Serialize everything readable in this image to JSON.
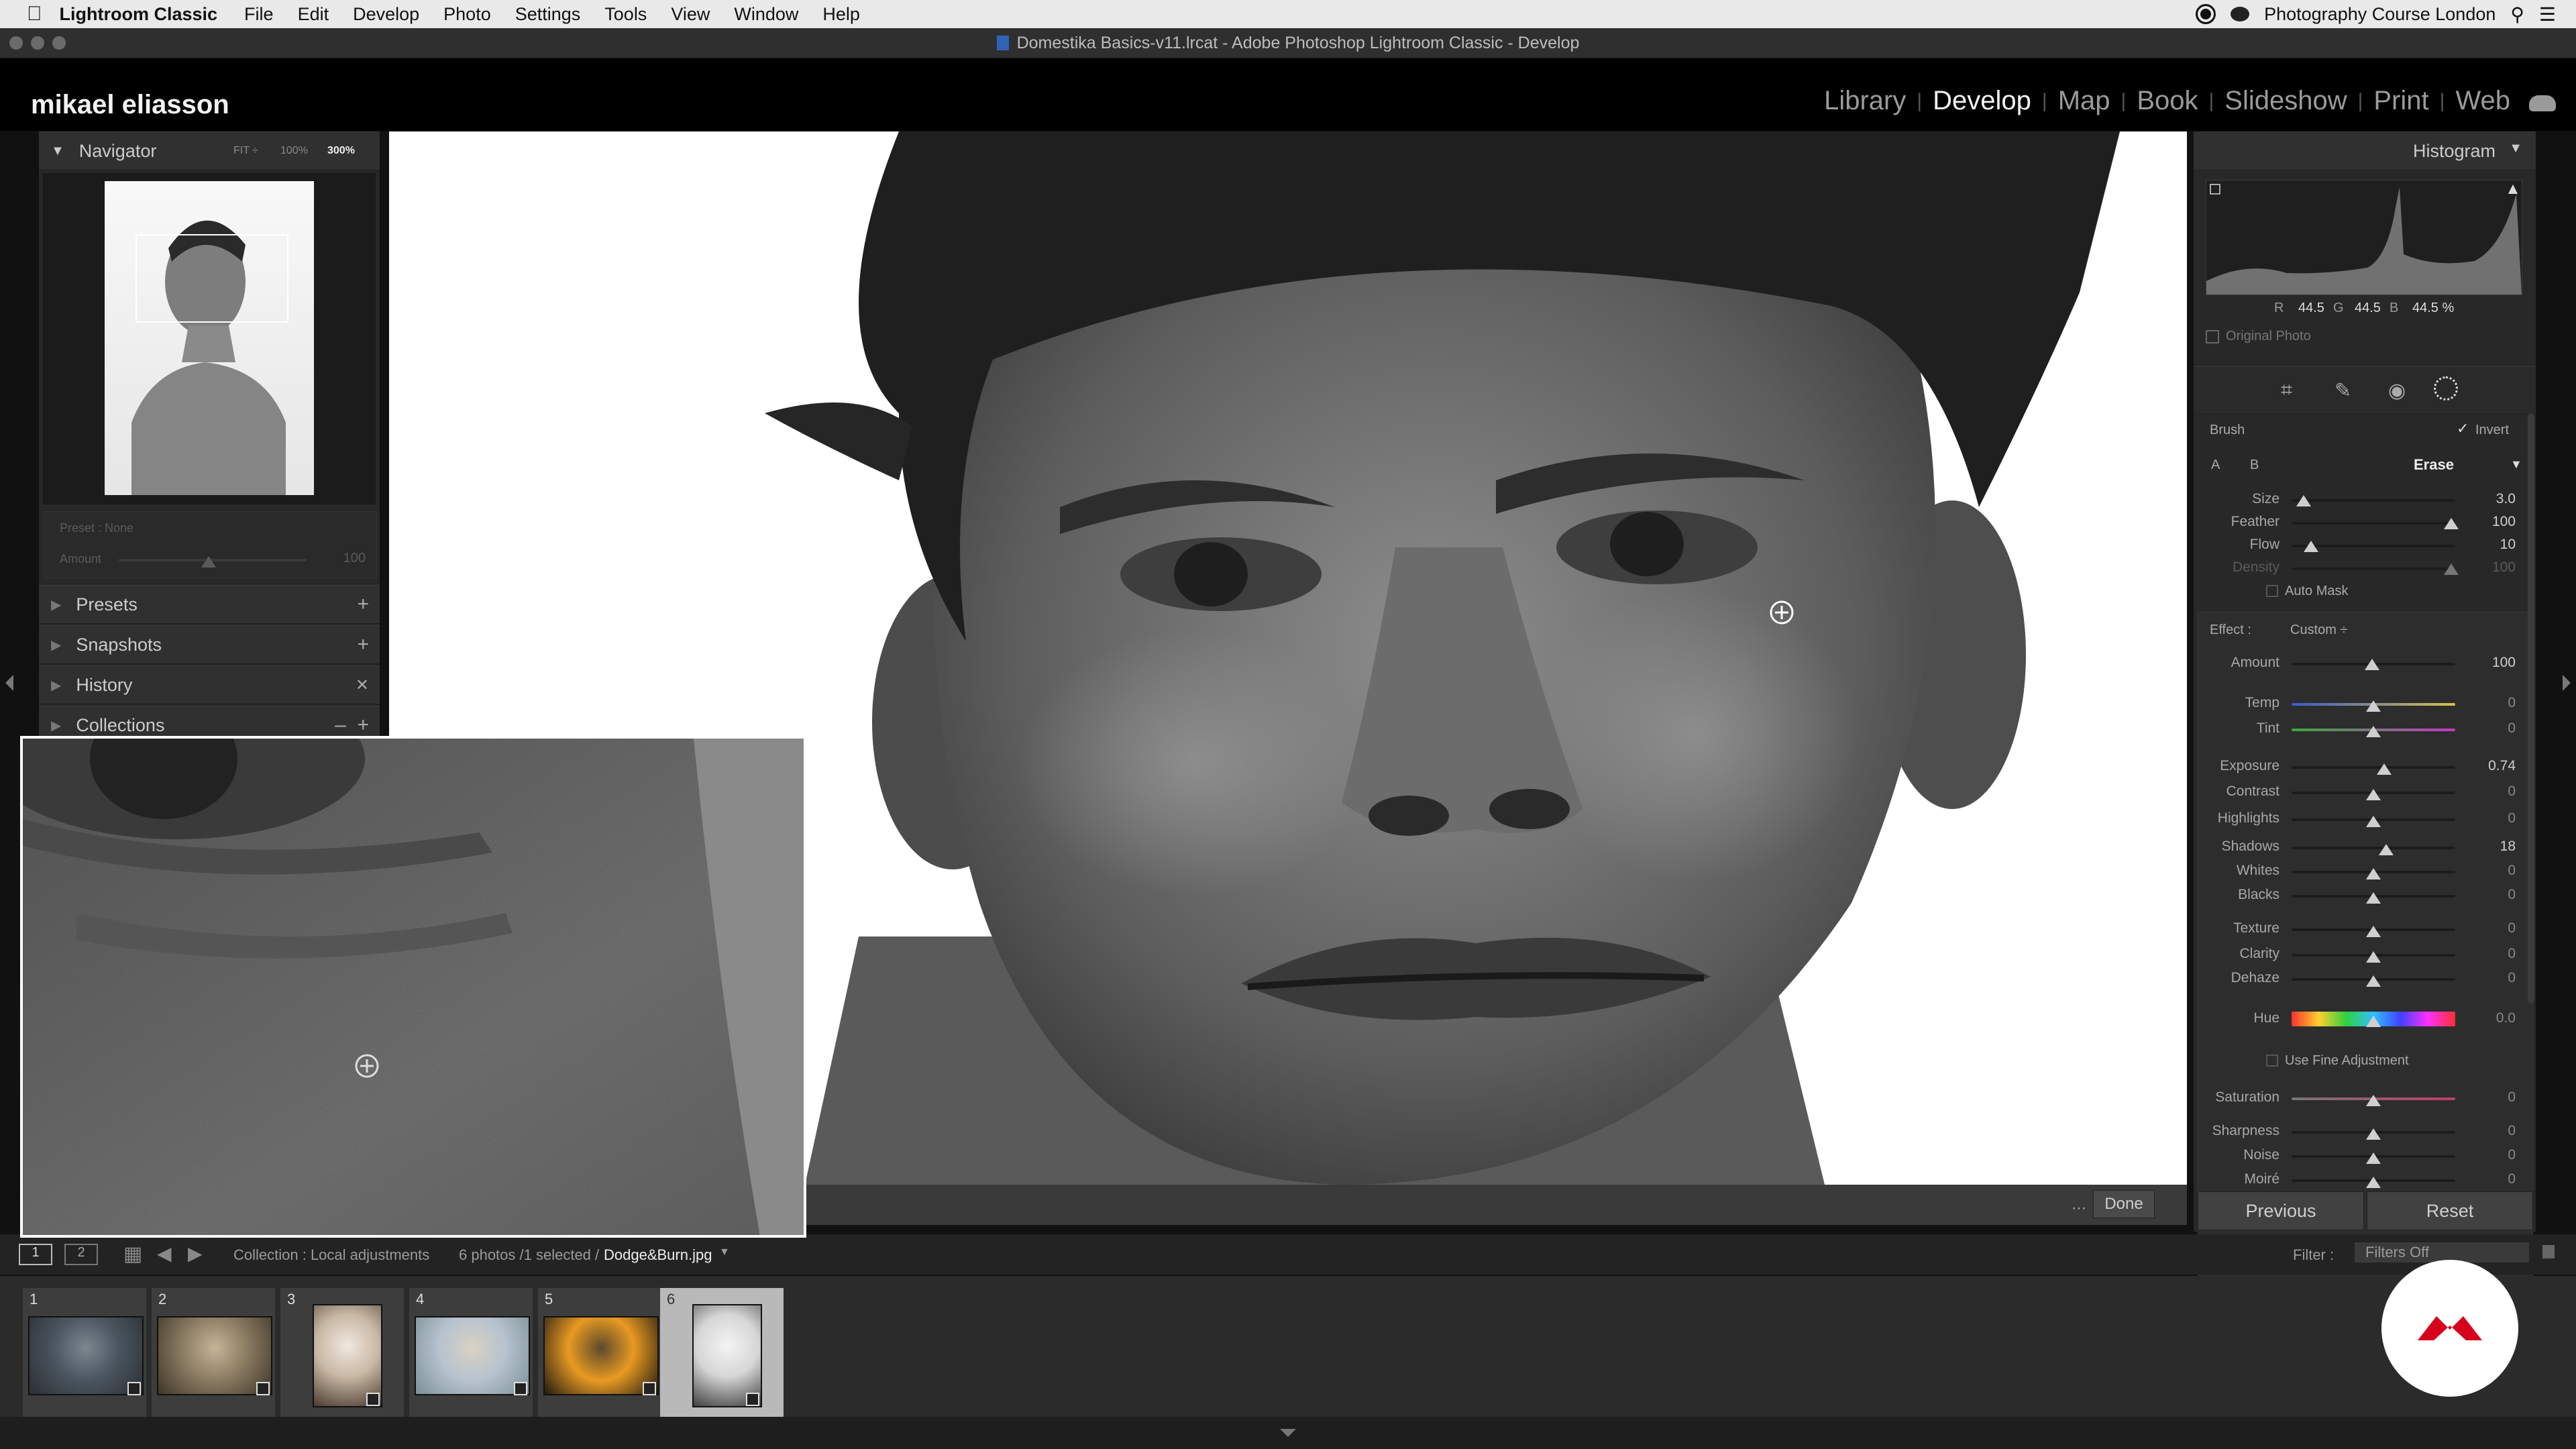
{
  "menubar": {
    "app_name": "Lightroom Classic",
    "items": [
      "File",
      "Edit",
      "Develop",
      "Photo",
      "Settings",
      "Tools",
      "View",
      "Window",
      "Help"
    ],
    "status_user": "Photography Course London"
  },
  "window": {
    "title": "Domestika Basics-v11.lrcat - Adobe Photoshop Lightroom Classic - Develop"
  },
  "identity_plate": "mikael eliasson",
  "modules": {
    "library": "Library",
    "develop": "Develop",
    "map": "Map",
    "book": "Book",
    "slideshow": "Slideshow",
    "print": "Print",
    "web": "Web",
    "active": "Develop"
  },
  "navigator": {
    "title": "Navigator",
    "zoom_fit": "FIT ÷",
    "zoom_100": "100%",
    "zoom_300": "300%",
    "preset_label": "Preset : None",
    "amount_label": "Amount",
    "amount_value": "100"
  },
  "left_panels": {
    "presets": "Presets",
    "snapshots": "Snapshots",
    "history": "History",
    "collections": "Collections"
  },
  "histogram": {
    "title": "Histogram",
    "r_label": "R",
    "r_value": "44.5",
    "g_label": "G",
    "g_value": "44.5",
    "b_label": "B",
    "b_value": "44.5 %",
    "original_photo": "Original Photo"
  },
  "brush": {
    "label": "Brush",
    "invert": "Invert",
    "tab_a": "A",
    "tab_b": "B",
    "tab_erase": "Erase",
    "size_label": "Size",
    "size_value": "3.0",
    "size_level": 0.05,
    "feather_label": "Feather",
    "feather_value": "100",
    "feather_level": 1.0,
    "flow_label": "Flow",
    "flow_value": "10",
    "flow_level": 0.1,
    "density_label": "Density",
    "density_value": "100",
    "density_level": 1.0,
    "automask": "Auto Mask"
  },
  "effect": {
    "label": "Effect :",
    "preset": "Custom ÷",
    "amount_label": "Amount",
    "amount_value": "100",
    "sliders": [
      {
        "label": "Temp",
        "value": "0",
        "level": 0.5
      },
      {
        "label": "Tint",
        "value": "0",
        "level": 0.5
      },
      {
        "label": "Exposure",
        "value": "0.74",
        "level": 0.57
      },
      {
        "label": "Contrast",
        "value": "0",
        "level": 0.5
      },
      {
        "label": "Highlights",
        "value": "0",
        "level": 0.5
      },
      {
        "label": "Shadows",
        "value": "18",
        "level": 0.58
      },
      {
        "label": "Whites",
        "value": "0",
        "level": 0.5
      },
      {
        "label": "Blacks",
        "value": "0",
        "level": 0.5
      },
      {
        "label": "Texture",
        "value": "0",
        "level": 0.5
      },
      {
        "label": "Clarity",
        "value": "0",
        "level": 0.5
      },
      {
        "label": "Dehaze",
        "value": "0",
        "level": 0.5
      },
      {
        "label": "Hue",
        "value": "0.0",
        "level": 0.5
      },
      {
        "label": "Saturation",
        "value": "0",
        "level": 0.5
      },
      {
        "label": "Sharpness",
        "value": "0",
        "level": 0.5
      },
      {
        "label": "Noise",
        "value": "0",
        "level": 0.5
      },
      {
        "label": "Moiré",
        "value": "0",
        "level": 0.5
      }
    ],
    "fine_adjust": "Use Fine Adjustment"
  },
  "buttons": {
    "done": "Done",
    "previous": "Previous",
    "reset": "Reset"
  },
  "filmstrip": {
    "screen1": "1",
    "screen2": "2",
    "collection_label": "Collection : Local adjustments",
    "count_label": "6 photos /1 selected /",
    "filename": "Dodge&Burn.jpg",
    "filter_label": "Filter :",
    "filter_value": "Filters Off",
    "thumbs": [
      {
        "num": "1",
        "colors": [
          "#4a5560",
          "#2c2f33",
          "#7d8790"
        ]
      },
      {
        "num": "2",
        "colors": [
          "#8a7b62",
          "#3f3629",
          "#c5b597"
        ]
      },
      {
        "num": "3",
        "colors": [
          "#c9b8a6",
          "#4c3c30",
          "#f0e8df"
        ]
      },
      {
        "num": "4",
        "colors": [
          "#b7c3cf",
          "#7c8f95",
          "#d9d2c3"
        ]
      },
      {
        "num": "5",
        "colors": [
          "#e89a22",
          "#201a12",
          "#5c4a2c"
        ]
      },
      {
        "num": "6",
        "colors": [
          "#d6d6d6",
          "#404040",
          "#f4f4f4"
        ]
      }
    ]
  },
  "colors": {
    "accent": "#f4f4f4",
    "panel": "#282828",
    "brand_red": "#d6001c"
  }
}
